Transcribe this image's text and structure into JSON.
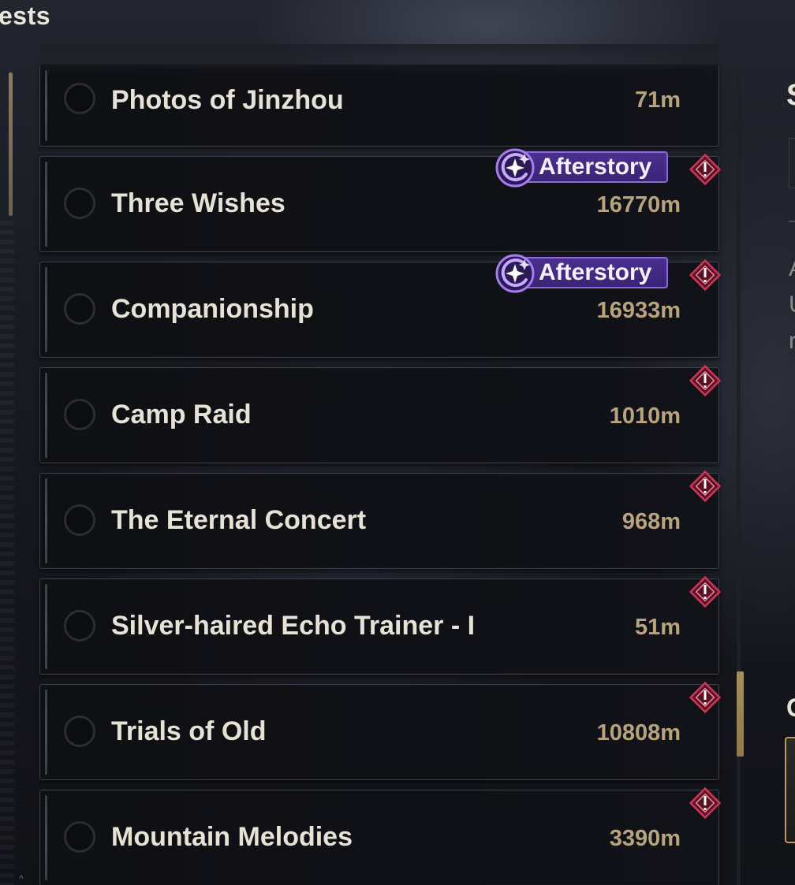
{
  "header": {
    "title_fragment": "ests"
  },
  "quests": [
    {
      "name": "Photos of Jinzhou",
      "distance": "71m",
      "afterstory": false,
      "alert": false
    },
    {
      "name": "Three Wishes",
      "distance": "16770m",
      "afterstory": true,
      "alert": true
    },
    {
      "name": "Companionship",
      "distance": "16933m",
      "afterstory": true,
      "alert": true
    },
    {
      "name": "Camp Raid",
      "distance": "1010m",
      "afterstory": false,
      "alert": true
    },
    {
      "name": "The Eternal Concert",
      "distance": "968m",
      "afterstory": false,
      "alert": true
    },
    {
      "name": "Silver-haired Echo Trainer - I",
      "distance": "51m",
      "afterstory": false,
      "alert": true
    },
    {
      "name": "Trials of Old",
      "distance": "10808m",
      "afterstory": false,
      "alert": true
    },
    {
      "name": "Mountain Melodies",
      "distance": "3390m",
      "afterstory": false,
      "alert": true
    }
  ],
  "badge": {
    "afterstory_label": "Afterstory",
    "icon": "afterstory-swirl-icon",
    "alert_icon": "exclamation-diamond-icon"
  },
  "detail_panel": {
    "heading_peek": "S",
    "text_peek_lines": [
      "A",
      "U",
      "r"
    ],
    "section_peek": "C"
  },
  "colors": {
    "distance": "#b8a47c",
    "afterstory_bg": "#4b2f8f",
    "afterstory_border": "#8a6ad6",
    "alert": "#c42a4a",
    "scroll_thumb": "#a58f5c"
  }
}
